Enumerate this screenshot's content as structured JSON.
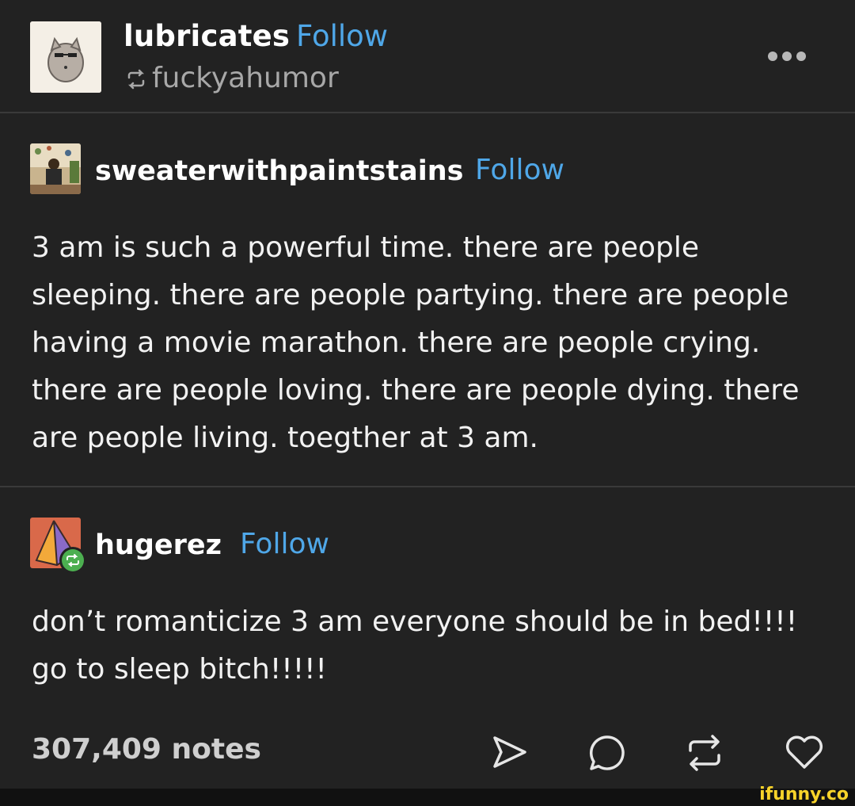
{
  "header": {
    "username": "lubricates",
    "follow_label": "Follow",
    "reblogged_from": "fuckyahumor"
  },
  "posts": [
    {
      "username": "sweaterwithpaintstains",
      "follow_label": "Follow",
      "text": "3 am is such a powerful time. there are people sleeping. there are people partying. there are people having a movie marathon. there are people crying. there are people loving. there are people dying. there are people living. toegther at 3 am."
    },
    {
      "username": "hugerez",
      "follow_label": "Follow",
      "text": "don’t romanticize 3 am everyone should be in bed!!!! go to sleep bitch!!!!!"
    }
  ],
  "footer": {
    "notes": "307,409 notes"
  },
  "watermark": "ifunny.co",
  "colors": {
    "background": "#222222",
    "follow": "#4fa7e8",
    "reblog_badge": "#4caf50",
    "watermark": "#f7d32a"
  }
}
